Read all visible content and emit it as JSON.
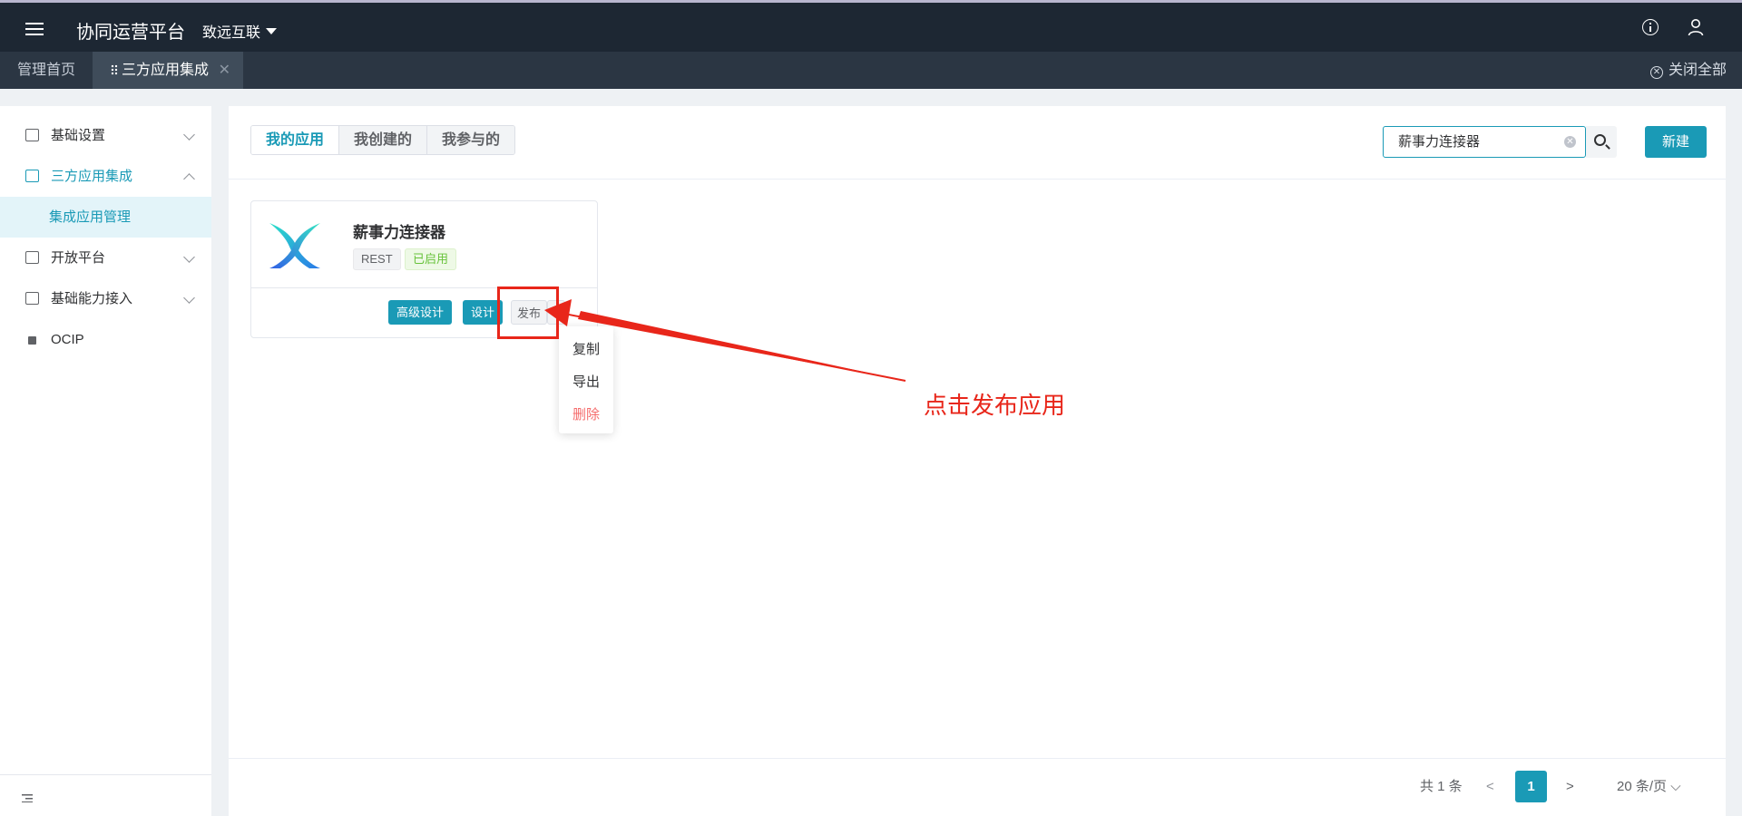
{
  "header": {
    "app_title": "协同运营平台",
    "org": "致远互联"
  },
  "tabs": {
    "home": "管理首页",
    "active": "三方应用集成",
    "close_all": "关闭全部"
  },
  "sidebar": {
    "items": [
      {
        "label": "基础设置"
      },
      {
        "label": "三方应用集成"
      },
      {
        "label": "集成应用管理"
      },
      {
        "label": "开放平台"
      },
      {
        "label": "基础能力接入"
      },
      {
        "label": "OCIP"
      }
    ]
  },
  "main": {
    "segments": [
      "我的应用",
      "我创建的",
      "我参与的"
    ],
    "search_value": "薪事力连接器",
    "new_label": "新建",
    "card": {
      "name": "薪事力连接器",
      "tag_type": "REST",
      "tag_status": "已启用",
      "btn_advanced": "高级设计",
      "btn_design": "设计",
      "btn_publish": "发布"
    },
    "dropdown": [
      "复制",
      "导出",
      "删除"
    ],
    "annotation": "点击发布应用",
    "pagination": {
      "total": "共 1 条",
      "current": "1",
      "page_size": "20 条/页"
    }
  },
  "colors": {
    "accent": "#1a9ab6",
    "topbar": "#1d2733",
    "annotation": "#e8261a",
    "danger": "#f56c6c",
    "success": "#67c23a"
  }
}
